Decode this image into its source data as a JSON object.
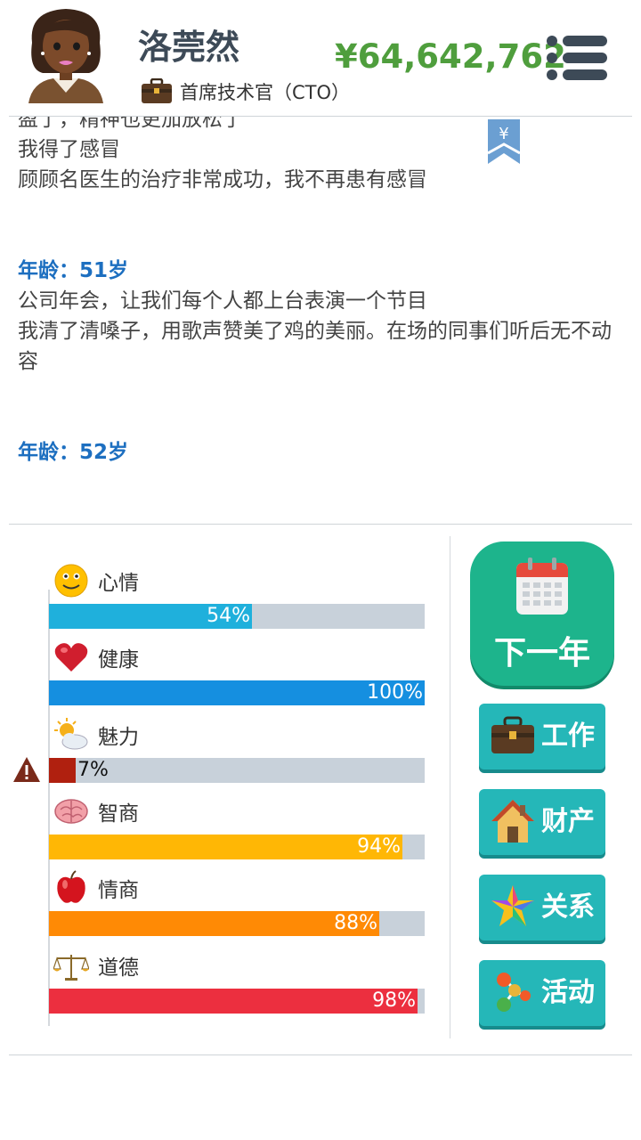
{
  "player": {
    "name": "洛莞然",
    "job": "首席技术官（CTO）",
    "money": "¥64,642,762"
  },
  "log": {
    "lines": [
      {
        "text": "盈了，精神也更加放松了",
        "type": "event"
      },
      {
        "text": "我得了感冒",
        "type": "event"
      },
      {
        "text": "顾顾名医生的治疗非常成功，我不再患有感冒",
        "type": "event"
      },
      {
        "text": "年龄：51岁",
        "type": "age"
      },
      {
        "text": "公司年会，让我们每个人都上台表演一个节目",
        "type": "event"
      },
      {
        "text": "我清了清嗓子，用歌声赞美了鸡的美丽。在场的同事们听后无不动容",
        "type": "event"
      },
      {
        "text": "年龄：52岁",
        "type": "age"
      }
    ],
    "bookmark_glyph": "¥"
  },
  "stats": [
    {
      "label": "心情",
      "value": 54,
      "text": "54%",
      "color": "#1fb0dc",
      "icon": "smiley-icon"
    },
    {
      "label": "健康",
      "value": 100,
      "text": "100%",
      "color": "#158fe0",
      "icon": "heart-icon"
    },
    {
      "label": "魅力",
      "value": 7,
      "text": "7%",
      "color": "#b0200f",
      "icon": "sun-cloud-icon",
      "warning": true
    },
    {
      "label": "智商",
      "value": 94,
      "text": "94%",
      "color": "#ffb705",
      "icon": "brain-icon"
    },
    {
      "label": "情商",
      "value": 88,
      "text": "88%",
      "color": "#ff8a05",
      "icon": "apple-icon"
    },
    {
      "label": "道德",
      "value": 98,
      "text": "98%",
      "color": "#ec2f3f",
      "icon": "scales-icon"
    }
  ],
  "buttons": {
    "next_year": "下一年",
    "work": "工作",
    "property": "财产",
    "relations": "关系",
    "activities": "活动"
  },
  "colors": {
    "money": "#4f9e3d",
    "age": "#1d6fc0",
    "next_year": "#1db48c",
    "side_button": "#25b7b8"
  }
}
